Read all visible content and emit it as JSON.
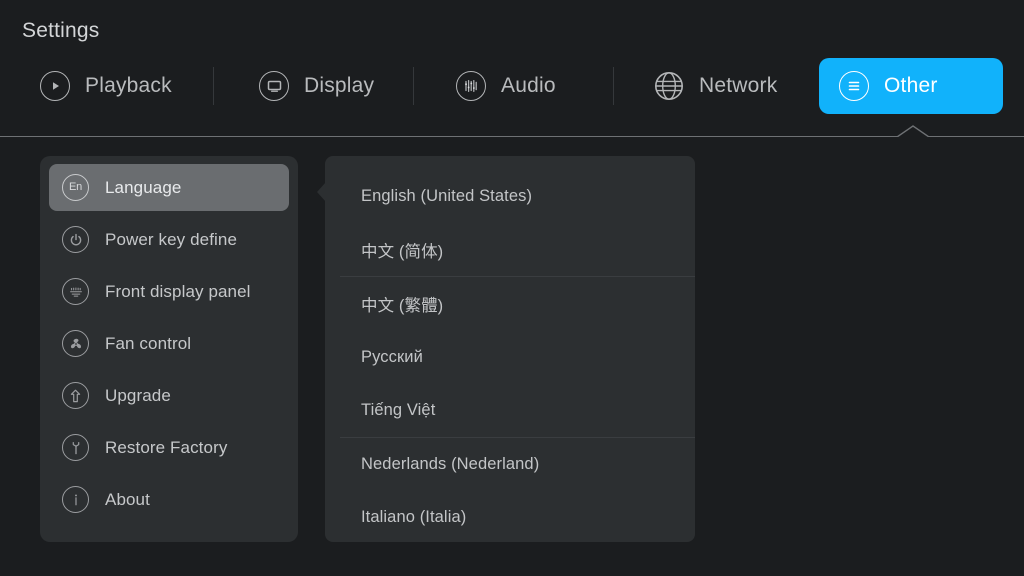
{
  "window": {
    "title": "Settings",
    "background_color": "#1b1d1f",
    "panel_color": "#2c2f31",
    "accent_color": "#11b2fb",
    "selected_color": "#6a6d70",
    "text_color": "#c6c8ca"
  },
  "topnav": {
    "tabs": [
      {
        "label": "Playback",
        "icon": "play-circle-icon",
        "active": false
      },
      {
        "label": "Display",
        "icon": "monitor-icon",
        "active": false
      },
      {
        "label": "Audio",
        "icon": "equalizer-icon",
        "active": false
      },
      {
        "label": "Network",
        "icon": "globe-icon",
        "active": false
      },
      {
        "label": "Other",
        "icon": "menu-lines-icon",
        "active": true
      }
    ]
  },
  "sidebar": {
    "items": [
      {
        "label": "Language",
        "icon": "en-badge-icon",
        "selected": true
      },
      {
        "label": "Power key define",
        "icon": "power-icon",
        "selected": false
      },
      {
        "label": "Front display panel",
        "icon": "vfd-panel-icon",
        "selected": false
      },
      {
        "label": "Fan control",
        "icon": "fan-icon",
        "selected": false
      },
      {
        "label": "Upgrade",
        "icon": "upgrade-arrow-icon",
        "selected": false
      },
      {
        "label": "Restore Factory",
        "icon": "wrench-icon",
        "selected": false
      },
      {
        "label": "About",
        "icon": "info-icon",
        "selected": false
      }
    ],
    "language_badge_text": "En"
  },
  "language_list": {
    "items": [
      {
        "label": "English (United States)",
        "divider_below": false
      },
      {
        "label": "中文 (简体)",
        "divider_below": true
      },
      {
        "label": "中文 (繁體)",
        "divider_below": false
      },
      {
        "label": "Русский",
        "divider_below": false
      },
      {
        "label": "Tiếng Việt",
        "divider_below": true
      },
      {
        "label": "Nederlands (Nederland)",
        "divider_below": false
      },
      {
        "label": "Italiano (Italia)",
        "divider_below": false
      }
    ]
  }
}
